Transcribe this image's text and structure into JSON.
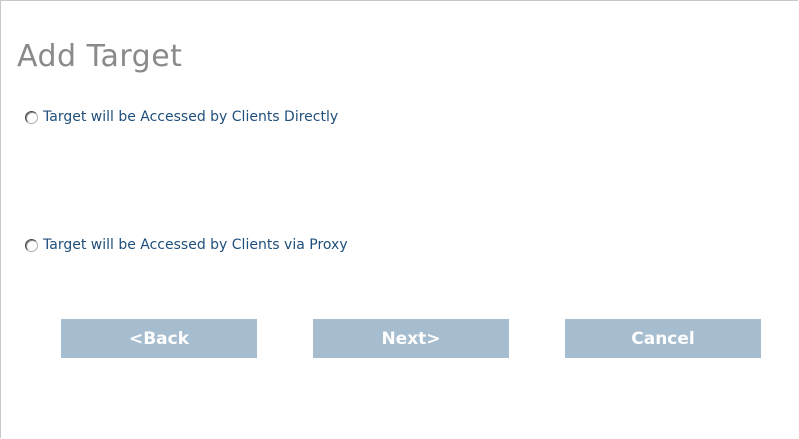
{
  "dialog": {
    "title": "Add Target"
  },
  "options": [
    {
      "label": "Target will be Accessed by Clients Directly",
      "selected": false
    },
    {
      "label": "Target will be Accessed by Clients via Proxy",
      "selected": false
    }
  ],
  "buttons": {
    "back_label": "<Back",
    "next_label": "Next>",
    "cancel_label": "Cancel"
  },
  "colors": {
    "title": "#8a8a8a",
    "option_text": "#1f4f7a",
    "button_bg": "#a6bccf",
    "button_text": "#ffffff"
  }
}
